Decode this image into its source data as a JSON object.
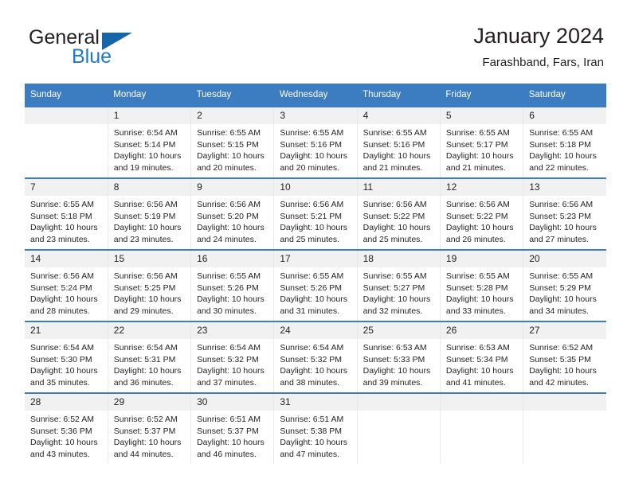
{
  "logo": {
    "word_one": "General",
    "word_two": "Blue",
    "triangle_color": "#1565a8",
    "blue_text_color": "#1f7ac4"
  },
  "header": {
    "title": "January 2024",
    "subtitle": "Farashband, Fars, Iran",
    "accent_color": "#3b7dc0",
    "daynum_band_color": "#f1f1f1"
  },
  "weekday_headers": [
    "Sunday",
    "Monday",
    "Tuesday",
    "Wednesday",
    "Thursday",
    "Friday",
    "Saturday"
  ],
  "labels": {
    "sunrise_prefix": "Sunrise:",
    "sunset_prefix": "Sunset:",
    "daylight_prefix": "Daylight:"
  },
  "weeks": [
    [
      {
        "day": "",
        "blank": true,
        "sunrise": "",
        "sunset": "",
        "daylight_line1": "",
        "daylight_line2": ""
      },
      {
        "day": "1",
        "blank": false,
        "sunrise": "Sunrise: 6:54 AM",
        "sunset": "Sunset: 5:14 PM",
        "daylight_line1": "Daylight: 10 hours",
        "daylight_line2": "and 19 minutes."
      },
      {
        "day": "2",
        "blank": false,
        "sunrise": "Sunrise: 6:55 AM",
        "sunset": "Sunset: 5:15 PM",
        "daylight_line1": "Daylight: 10 hours",
        "daylight_line2": "and 20 minutes."
      },
      {
        "day": "3",
        "blank": false,
        "sunrise": "Sunrise: 6:55 AM",
        "sunset": "Sunset: 5:16 PM",
        "daylight_line1": "Daylight: 10 hours",
        "daylight_line2": "and 20 minutes."
      },
      {
        "day": "4",
        "blank": false,
        "sunrise": "Sunrise: 6:55 AM",
        "sunset": "Sunset: 5:16 PM",
        "daylight_line1": "Daylight: 10 hours",
        "daylight_line2": "and 21 minutes."
      },
      {
        "day": "5",
        "blank": false,
        "sunrise": "Sunrise: 6:55 AM",
        "sunset": "Sunset: 5:17 PM",
        "daylight_line1": "Daylight: 10 hours",
        "daylight_line2": "and 21 minutes."
      },
      {
        "day": "6",
        "blank": false,
        "sunrise": "Sunrise: 6:55 AM",
        "sunset": "Sunset: 5:18 PM",
        "daylight_line1": "Daylight: 10 hours",
        "daylight_line2": "and 22 minutes."
      }
    ],
    [
      {
        "day": "7",
        "blank": false,
        "sunrise": "Sunrise: 6:55 AM",
        "sunset": "Sunset: 5:18 PM",
        "daylight_line1": "Daylight: 10 hours",
        "daylight_line2": "and 23 minutes."
      },
      {
        "day": "8",
        "blank": false,
        "sunrise": "Sunrise: 6:56 AM",
        "sunset": "Sunset: 5:19 PM",
        "daylight_line1": "Daylight: 10 hours",
        "daylight_line2": "and 23 minutes."
      },
      {
        "day": "9",
        "blank": false,
        "sunrise": "Sunrise: 6:56 AM",
        "sunset": "Sunset: 5:20 PM",
        "daylight_line1": "Daylight: 10 hours",
        "daylight_line2": "and 24 minutes."
      },
      {
        "day": "10",
        "blank": false,
        "sunrise": "Sunrise: 6:56 AM",
        "sunset": "Sunset: 5:21 PM",
        "daylight_line1": "Daylight: 10 hours",
        "daylight_line2": "and 25 minutes."
      },
      {
        "day": "11",
        "blank": false,
        "sunrise": "Sunrise: 6:56 AM",
        "sunset": "Sunset: 5:22 PM",
        "daylight_line1": "Daylight: 10 hours",
        "daylight_line2": "and 25 minutes."
      },
      {
        "day": "12",
        "blank": false,
        "sunrise": "Sunrise: 6:56 AM",
        "sunset": "Sunset: 5:22 PM",
        "daylight_line1": "Daylight: 10 hours",
        "daylight_line2": "and 26 minutes."
      },
      {
        "day": "13",
        "blank": false,
        "sunrise": "Sunrise: 6:56 AM",
        "sunset": "Sunset: 5:23 PM",
        "daylight_line1": "Daylight: 10 hours",
        "daylight_line2": "and 27 minutes."
      }
    ],
    [
      {
        "day": "14",
        "blank": false,
        "sunrise": "Sunrise: 6:56 AM",
        "sunset": "Sunset: 5:24 PM",
        "daylight_line1": "Daylight: 10 hours",
        "daylight_line2": "and 28 minutes."
      },
      {
        "day": "15",
        "blank": false,
        "sunrise": "Sunrise: 6:56 AM",
        "sunset": "Sunset: 5:25 PM",
        "daylight_line1": "Daylight: 10 hours",
        "daylight_line2": "and 29 minutes."
      },
      {
        "day": "16",
        "blank": false,
        "sunrise": "Sunrise: 6:55 AM",
        "sunset": "Sunset: 5:26 PM",
        "daylight_line1": "Daylight: 10 hours",
        "daylight_line2": "and 30 minutes."
      },
      {
        "day": "17",
        "blank": false,
        "sunrise": "Sunrise: 6:55 AM",
        "sunset": "Sunset: 5:26 PM",
        "daylight_line1": "Daylight: 10 hours",
        "daylight_line2": "and 31 minutes."
      },
      {
        "day": "18",
        "blank": false,
        "sunrise": "Sunrise: 6:55 AM",
        "sunset": "Sunset: 5:27 PM",
        "daylight_line1": "Daylight: 10 hours",
        "daylight_line2": "and 32 minutes."
      },
      {
        "day": "19",
        "blank": false,
        "sunrise": "Sunrise: 6:55 AM",
        "sunset": "Sunset: 5:28 PM",
        "daylight_line1": "Daylight: 10 hours",
        "daylight_line2": "and 33 minutes."
      },
      {
        "day": "20",
        "blank": false,
        "sunrise": "Sunrise: 6:55 AM",
        "sunset": "Sunset: 5:29 PM",
        "daylight_line1": "Daylight: 10 hours",
        "daylight_line2": "and 34 minutes."
      }
    ],
    [
      {
        "day": "21",
        "blank": false,
        "sunrise": "Sunrise: 6:54 AM",
        "sunset": "Sunset: 5:30 PM",
        "daylight_line1": "Daylight: 10 hours",
        "daylight_line2": "and 35 minutes."
      },
      {
        "day": "22",
        "blank": false,
        "sunrise": "Sunrise: 6:54 AM",
        "sunset": "Sunset: 5:31 PM",
        "daylight_line1": "Daylight: 10 hours",
        "daylight_line2": "and 36 minutes."
      },
      {
        "day": "23",
        "blank": false,
        "sunrise": "Sunrise: 6:54 AM",
        "sunset": "Sunset: 5:32 PM",
        "daylight_line1": "Daylight: 10 hours",
        "daylight_line2": "and 37 minutes."
      },
      {
        "day": "24",
        "blank": false,
        "sunrise": "Sunrise: 6:54 AM",
        "sunset": "Sunset: 5:32 PM",
        "daylight_line1": "Daylight: 10 hours",
        "daylight_line2": "and 38 minutes."
      },
      {
        "day": "25",
        "blank": false,
        "sunrise": "Sunrise: 6:53 AM",
        "sunset": "Sunset: 5:33 PM",
        "daylight_line1": "Daylight: 10 hours",
        "daylight_line2": "and 39 minutes."
      },
      {
        "day": "26",
        "blank": false,
        "sunrise": "Sunrise: 6:53 AM",
        "sunset": "Sunset: 5:34 PM",
        "daylight_line1": "Daylight: 10 hours",
        "daylight_line2": "and 41 minutes."
      },
      {
        "day": "27",
        "blank": false,
        "sunrise": "Sunrise: 6:52 AM",
        "sunset": "Sunset: 5:35 PM",
        "daylight_line1": "Daylight: 10 hours",
        "daylight_line2": "and 42 minutes."
      }
    ],
    [
      {
        "day": "28",
        "blank": false,
        "sunrise": "Sunrise: 6:52 AM",
        "sunset": "Sunset: 5:36 PM",
        "daylight_line1": "Daylight: 10 hours",
        "daylight_line2": "and 43 minutes."
      },
      {
        "day": "29",
        "blank": false,
        "sunrise": "Sunrise: 6:52 AM",
        "sunset": "Sunset: 5:37 PM",
        "daylight_line1": "Daylight: 10 hours",
        "daylight_line2": "and 44 minutes."
      },
      {
        "day": "30",
        "blank": false,
        "sunrise": "Sunrise: 6:51 AM",
        "sunset": "Sunset: 5:37 PM",
        "daylight_line1": "Daylight: 10 hours",
        "daylight_line2": "and 46 minutes."
      },
      {
        "day": "31",
        "blank": false,
        "sunrise": "Sunrise: 6:51 AM",
        "sunset": "Sunset: 5:38 PM",
        "daylight_line1": "Daylight: 10 hours",
        "daylight_line2": "and 47 minutes."
      },
      {
        "day": "",
        "blank": true,
        "sunrise": "",
        "sunset": "",
        "daylight_line1": "",
        "daylight_line2": ""
      },
      {
        "day": "",
        "blank": true,
        "sunrise": "",
        "sunset": "",
        "daylight_line1": "",
        "daylight_line2": ""
      },
      {
        "day": "",
        "blank": true,
        "sunrise": "",
        "sunset": "",
        "daylight_line1": "",
        "daylight_line2": ""
      }
    ]
  ]
}
